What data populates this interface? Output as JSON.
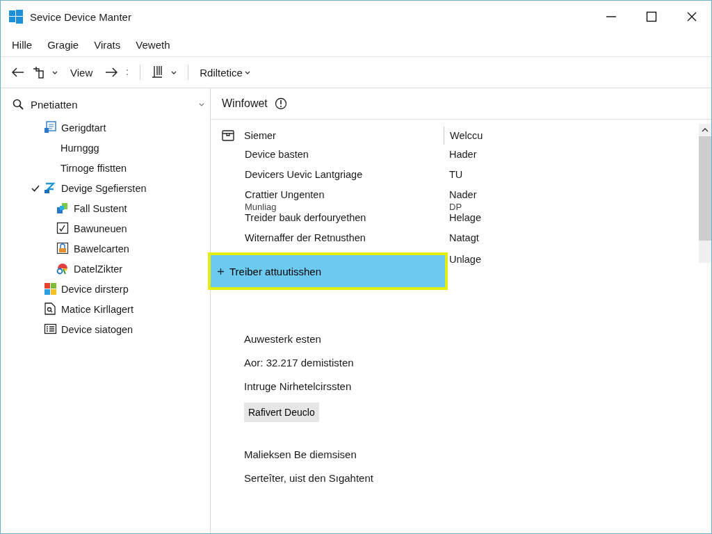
{
  "window": {
    "title": "Sevice Device Manter"
  },
  "menu": [
    "Hille",
    "Gragie",
    "Virats",
    "Veweth"
  ],
  "toolbar": {
    "view": "View",
    "filter": "Rdiltetice"
  },
  "sidebar": {
    "search": "Pnetiatten",
    "items": [
      {
        "label": "Gerigdtart",
        "kind": "panel",
        "checked": false,
        "children": [
          {
            "label": "Hurnggg",
            "kind": "none",
            "checked": false
          },
          {
            "label": "Tirnoge ffistten",
            "kind": "none",
            "checked": false
          }
        ]
      },
      {
        "label": "Devige Sgefiersten",
        "kind": "plug",
        "checked": true,
        "children": [
          {
            "label": "Fall Sustent",
            "kind": "blocks",
            "checked": false
          },
          {
            "label": "Bawuneuen",
            "kind": "tick",
            "checked": false
          },
          {
            "label": "Bawelcarten",
            "kind": "lock",
            "checked": false
          },
          {
            "label": "DatelZikter",
            "kind": "palette",
            "checked": false
          }
        ]
      },
      {
        "label": "Device dirsterp",
        "kind": "windows",
        "checked": false
      },
      {
        "label": "Matice Kirllagert",
        "kind": "doc",
        "checked": false
      },
      {
        "label": "Device siatogen",
        "kind": "list",
        "checked": false
      }
    ]
  },
  "main": {
    "title": "Winfowet",
    "table": {
      "columns": [
        "Siemer",
        "Welccu"
      ],
      "rows": [
        {
          "name": "Device basten",
          "value": "Hader"
        },
        {
          "name": "Devicers Uevic Lantgriage",
          "value": "TU"
        },
        {
          "name": "Crattier Ungenten",
          "sub": "Munliag",
          "value": "Nader",
          "value_sub": "DP"
        },
        {
          "name": "Treider bauk derfouryethen",
          "value": "Helage"
        },
        {
          "name": "Witernaffer der Retnusthen",
          "value": "Natagt"
        }
      ]
    },
    "action": {
      "label": "Treiber attuutisshen",
      "value": "Unlage",
      "selected": true
    },
    "details": [
      "Auwesterk esten",
      "Aor: 32.217 demististen",
      "Intruge Nirhetelcirssten"
    ],
    "button": "Rafivert Deuclo",
    "footer": [
      "Malieksen Be diemsisen",
      "Serteîter, uist den Sıgahtent"
    ]
  }
}
